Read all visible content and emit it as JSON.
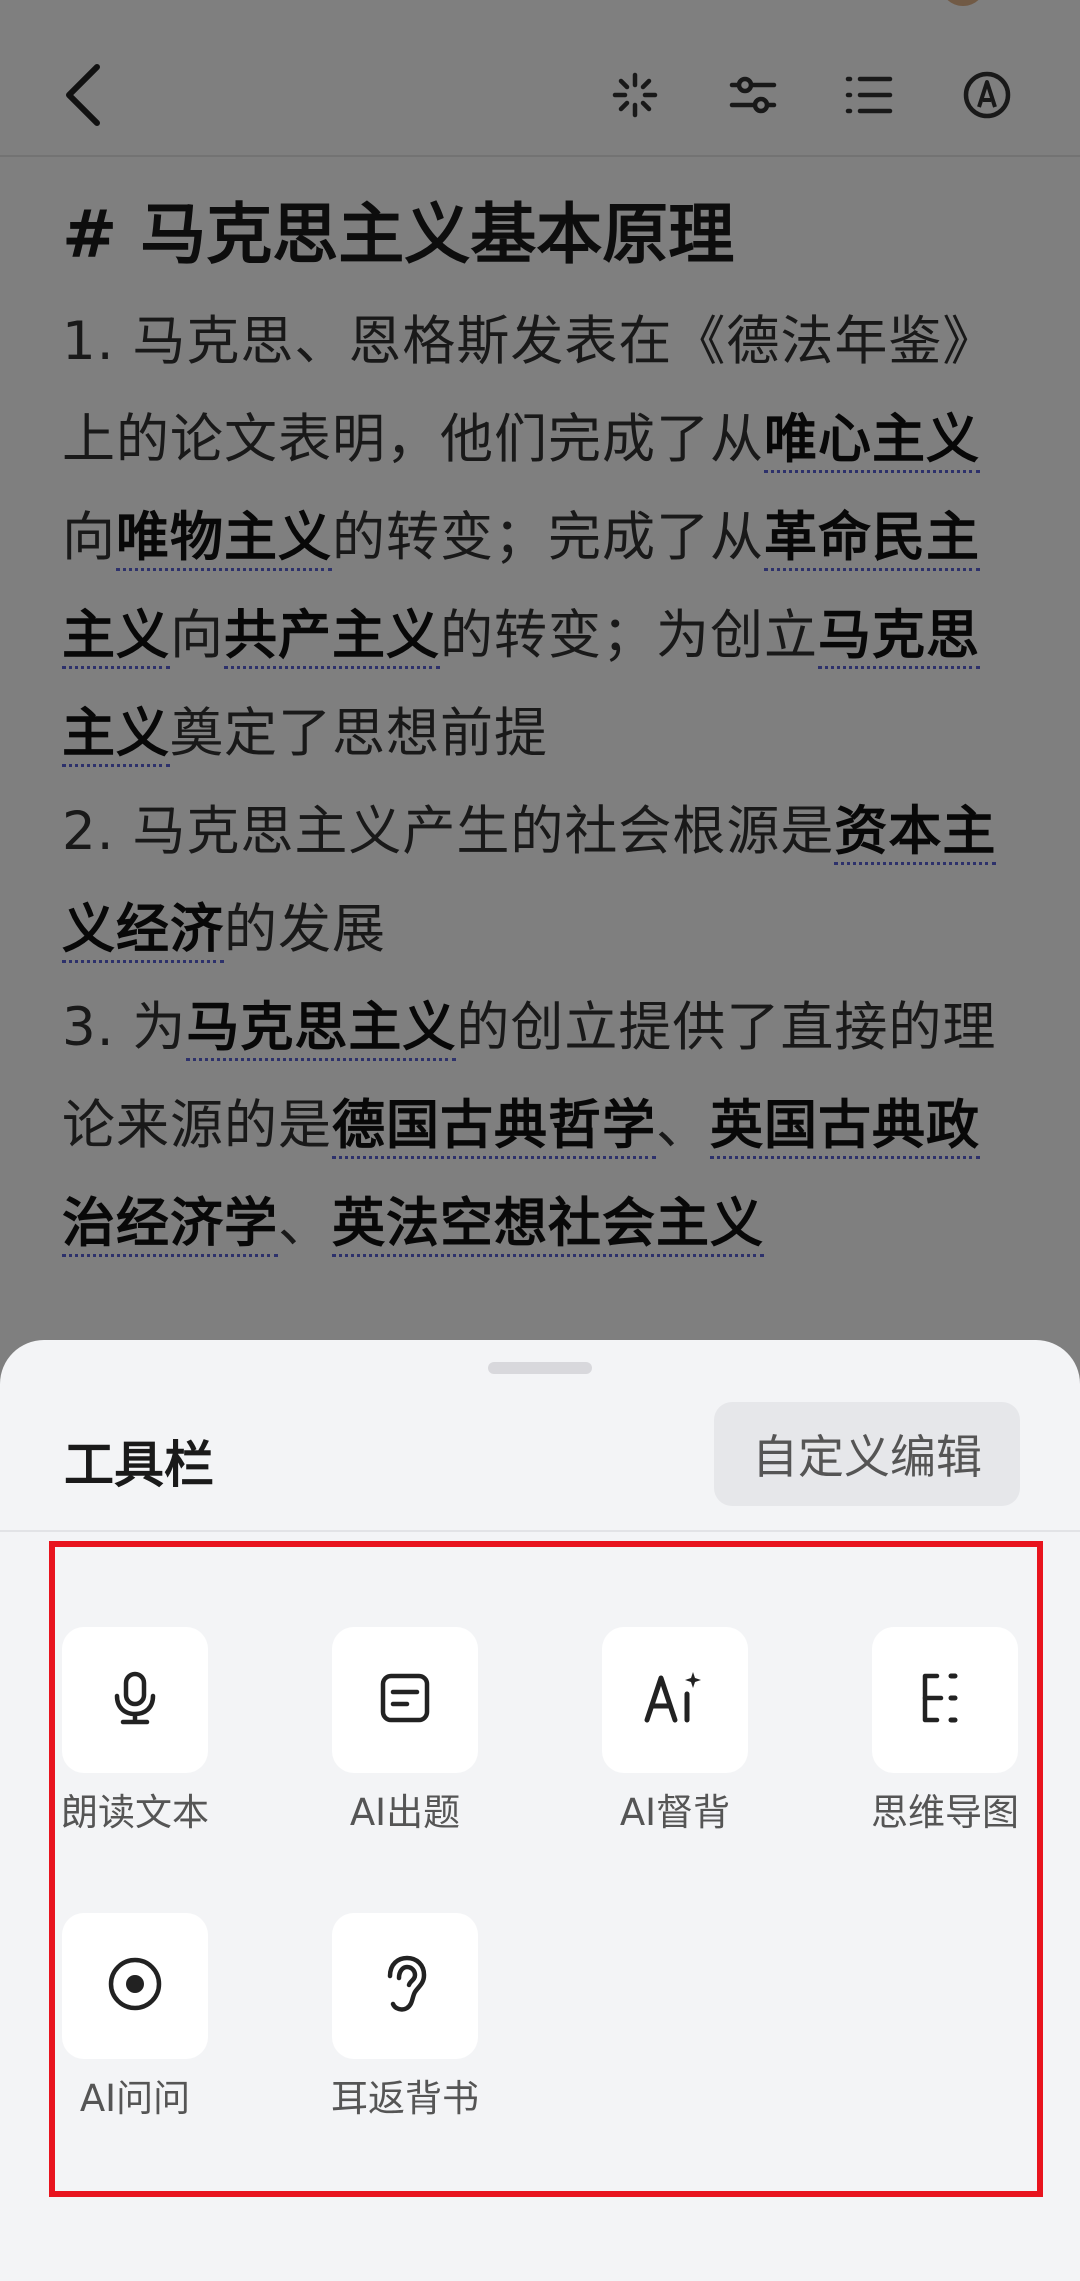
{
  "topbar": {
    "icons": [
      "back-icon",
      "sparkle-icon",
      "sliders-icon",
      "list-icon",
      "pen-circle-icon"
    ]
  },
  "document": {
    "title": "# 马克思主义基本原理",
    "paragraphs": [
      [
        {
          "t": "1. 马克思、恩格斯发表在《德法年鉴》上的论文表明，他们完成了从"
        },
        {
          "t": "唯心主义",
          "kw": true
        },
        {
          "t": "向"
        },
        {
          "t": "唯物主义",
          "kw": true
        },
        {
          "t": "的转变；完成了从"
        },
        {
          "t": "革命民主主义",
          "kw": true
        },
        {
          "t": "向"
        },
        {
          "t": "共产主义",
          "kw": true
        },
        {
          "t": "的转变；为创立"
        },
        {
          "t": "马克思主义",
          "kw": true
        },
        {
          "t": "奠定了思想前提"
        }
      ],
      [
        {
          "t": "2. 马克思主义产生的社会根源是"
        },
        {
          "t": "资本主义经济",
          "kw": true
        },
        {
          "t": "的发展"
        }
      ],
      [
        {
          "t": "3. 为"
        },
        {
          "t": "马克思主义",
          "kw": true
        },
        {
          "t": "的创立提供了直接的理论来源的是"
        },
        {
          "t": "德国古典哲学",
          "kw": true
        },
        {
          "t": "、"
        },
        {
          "t": "英国古典政治经济学",
          "kw": true
        },
        {
          "t": "、"
        },
        {
          "t": "英法空想社会主义",
          "kw": true
        }
      ]
    ]
  },
  "sheet": {
    "title": "工具栏",
    "custom_button": "自定义编辑",
    "tools": [
      {
        "label": "朗读文本",
        "icon": "microphone-icon"
      },
      {
        "label": "AI出题",
        "icon": "document-icon"
      },
      {
        "label": "AI督背",
        "icon": "ai-sparkle-icon"
      },
      {
        "label": "思维导图",
        "icon": "mindmap-icon"
      },
      {
        "label": "AI问问",
        "icon": "record-circle-icon"
      },
      {
        "label": "耳返背书",
        "icon": "ear-icon"
      }
    ]
  },
  "colors": {
    "overlay": "#000000",
    "sheet_bg": "#f3f4f6",
    "highlight": "#e8141e",
    "keyword_underline": "#5a62d6"
  }
}
